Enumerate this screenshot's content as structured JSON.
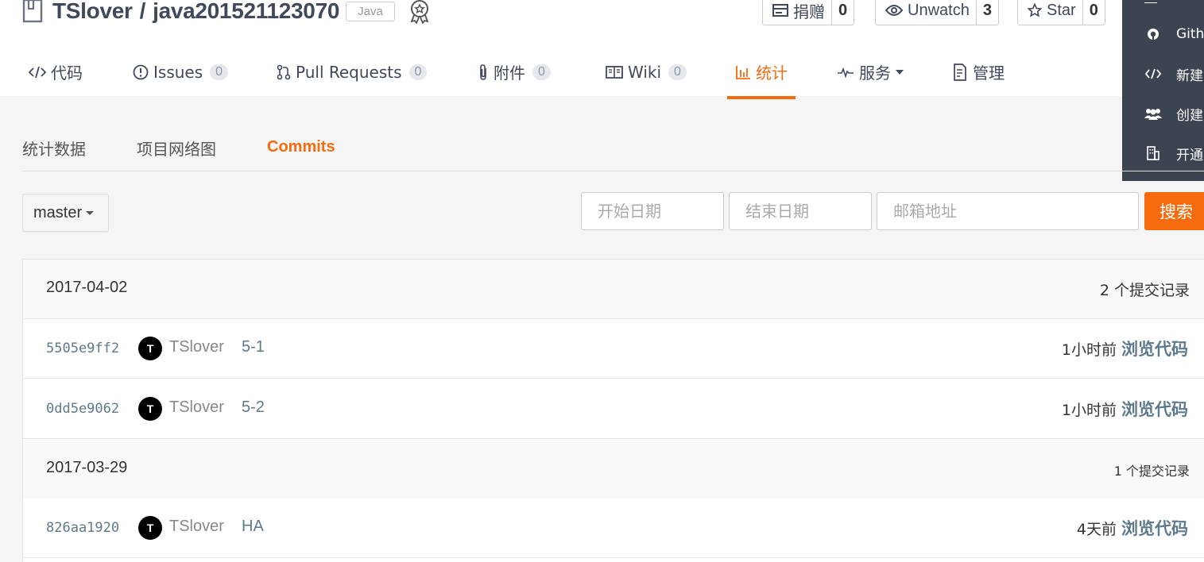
{
  "repo": {
    "owner": "TSlover",
    "separator": "/",
    "name": "java201521123070",
    "language": "Java"
  },
  "actions": {
    "donate": {
      "label": "捐赠",
      "count": "0"
    },
    "watch": {
      "label": "Unwatch",
      "count": "3"
    },
    "star": {
      "label": "Star",
      "count": "0"
    }
  },
  "tabs": [
    {
      "label": "代码",
      "icon": "code-icon"
    },
    {
      "label": "Issues",
      "count": "0",
      "icon": "issue-icon"
    },
    {
      "label": "Pull Requests",
      "count": "0",
      "icon": "pull-request-icon"
    },
    {
      "label": "附件",
      "count": "0",
      "icon": "paperclip-icon"
    },
    {
      "label": "Wiki",
      "count": "0",
      "icon": "book-icon"
    },
    {
      "label": "统计",
      "icon": "chart-icon",
      "active": true
    },
    {
      "label": "服务",
      "icon": "pulse-icon",
      "dropdown": true
    },
    {
      "label": "管理",
      "icon": "settings-doc-icon"
    }
  ],
  "side_menu": [
    {
      "label": "Gith",
      "icon": "github-icon"
    },
    {
      "label": "新建",
      "icon": "code-icon"
    },
    {
      "label": "创建",
      "icon": "group-icon"
    },
    {
      "label": "开通",
      "icon": "building-icon"
    }
  ],
  "subtabs": [
    {
      "label": "统计数据"
    },
    {
      "label": "项目网络图"
    },
    {
      "label": "Commits",
      "active": true
    }
  ],
  "filters": {
    "branch": "master",
    "start_date_placeholder": "开始日期",
    "end_date_placeholder": "结束日期",
    "email_placeholder": "邮箱地址",
    "search_label": "搜索"
  },
  "groups": [
    {
      "date": "2017-04-02",
      "count": "2 个提交记录",
      "commits": [
        {
          "sha": "5505e9ff2",
          "avatar": "T",
          "author": "TSlover",
          "message": "5-1",
          "time": "1小时前",
          "browse": "浏览代码"
        },
        {
          "sha": "0dd5e9062",
          "avatar": "T",
          "author": "TSlover",
          "message": "5-2",
          "time": "1小时前",
          "browse": "浏览代码"
        }
      ]
    },
    {
      "date": "2017-03-29",
      "count": "1 个提交记录",
      "commits": [
        {
          "sha": "826aa1920",
          "avatar": "T",
          "author": "TSlover",
          "message": "HA",
          "time": "4天前",
          "browse": "浏览代码"
        }
      ]
    }
  ],
  "colors": {
    "accent": "#f56b0d",
    "link": "#5d7a8c",
    "menu_bg": "#3c4451"
  }
}
